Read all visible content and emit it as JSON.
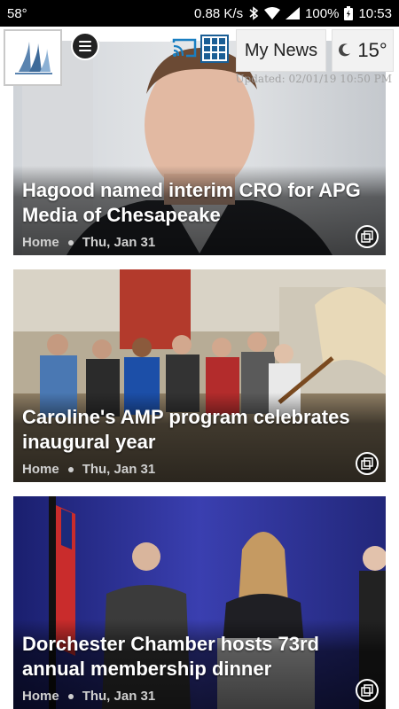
{
  "status_bar": {
    "left_text": "58°",
    "speed": "0.88 K/s",
    "battery": "100%",
    "time": "10:53"
  },
  "header": {
    "my_news_label": "My News",
    "temperature": "15°",
    "updated_text": "Updated: 02/01/19 10:50 PM"
  },
  "articles": [
    {
      "title": "Hagood named interim CRO for APG Media of Chesapeake",
      "section": "Home",
      "date": "Thu, Jan 31"
    },
    {
      "title": "Caroline's AMP program celebrates inaugural year",
      "section": "Home",
      "date": "Thu, Jan 31"
    },
    {
      "title": "Dorchester Chamber hosts 73rd annual membership dinner",
      "section": "Home",
      "date": "Thu, Jan 31"
    }
  ],
  "icons": {
    "logo": "sailboat-logo",
    "menu": "hamburger-menu-icon",
    "cast": "cast-icon",
    "grid": "grid-view-icon",
    "weather": "moon-weather-icon",
    "gallery": "gallery-icon"
  },
  "colors": {
    "grid_icon": "#1a5e95",
    "cast_icon": "#1a7fc1"
  }
}
